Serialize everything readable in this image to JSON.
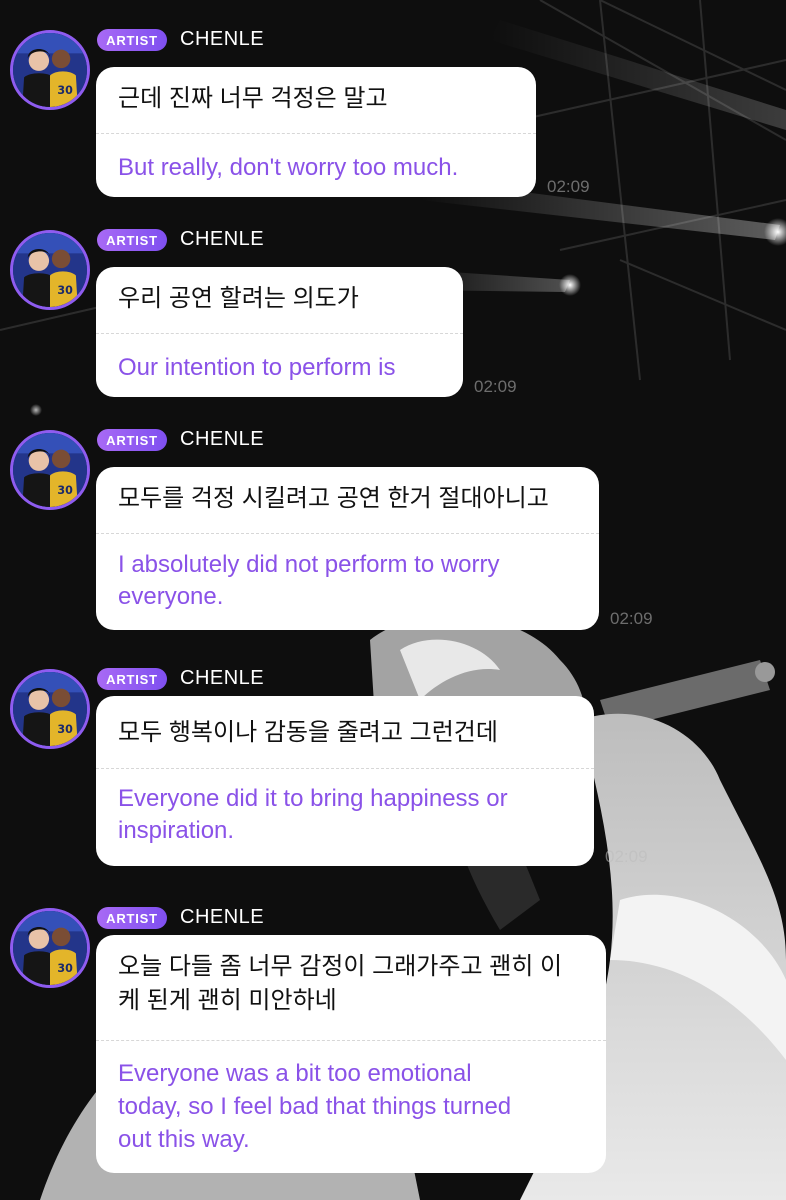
{
  "theme": {
    "accent": "#8f5cf0",
    "badge_gradient": [
      "#a86af5",
      "#7f4ff0"
    ],
    "translation_color": "#8a52e8",
    "bubble_color": "#ffffff"
  },
  "messages": [
    {
      "badge": "ARTIST",
      "author": "CHENLE",
      "korean": [
        "근데 진짜 너무 걱정은 말고"
      ],
      "english": [
        "But really, don't worry too much."
      ],
      "time": "02:09"
    },
    {
      "badge": "ARTIST",
      "author": "CHENLE",
      "korean": [
        "우리 공연 할려는 의도가"
      ],
      "english": [
        "Our intention to perform is"
      ],
      "time": "02:09"
    },
    {
      "badge": "ARTIST",
      "author": "CHENLE",
      "korean": [
        "모두를 걱정 시킬려고 공연 한거 절대아니고"
      ],
      "english": [
        "I absolutely did not perform to worry",
        "everyone."
      ],
      "time": "02:09"
    },
    {
      "badge": "ARTIST",
      "author": "CHENLE",
      "korean": [
        "모두 행복이나 감동을 줄려고 그런건데"
      ],
      "english": [
        "Everyone did it to bring happiness or",
        "inspiration."
      ],
      "time": "02:09"
    },
    {
      "badge": "ARTIST",
      "author": "CHENLE",
      "korean": [
        "오늘 다들 좀 너무 감정이 그래가주고 괜히 이",
        "케 된게 괜히 미안하네"
      ],
      "english": [
        "Everyone was a bit too emotional",
        "today, so I feel bad that things turned",
        "out this way."
      ],
      "time": ""
    }
  ]
}
